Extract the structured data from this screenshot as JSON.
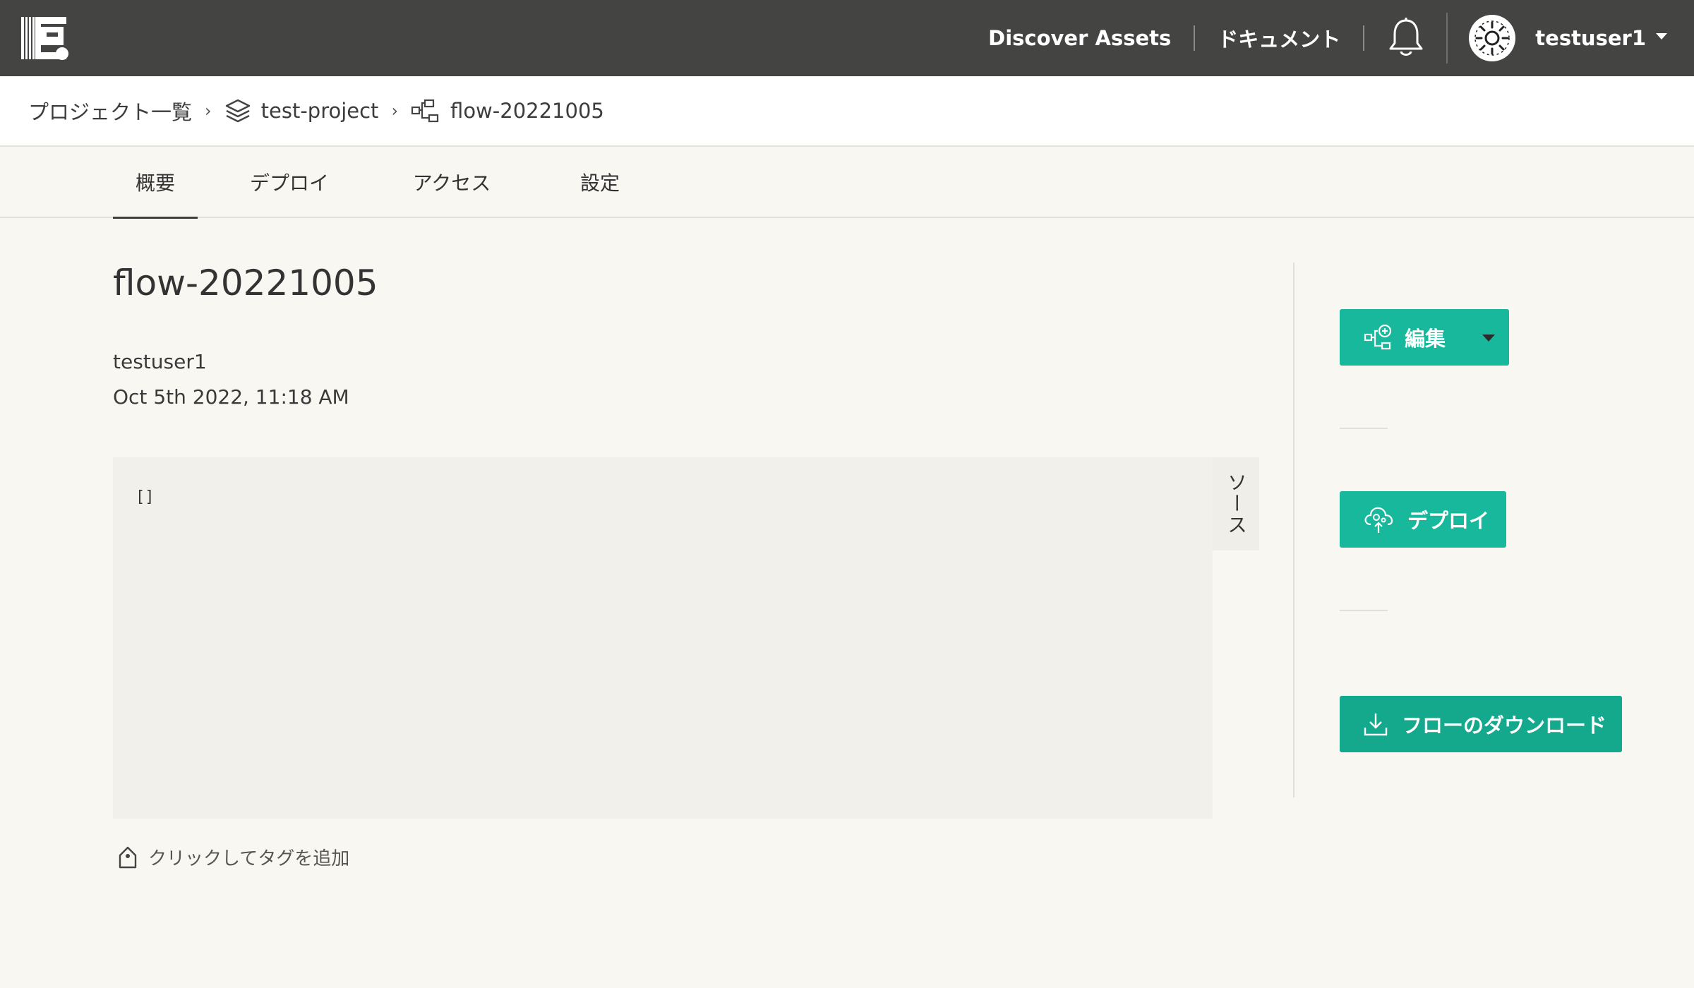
{
  "header": {
    "discover_label": "Discover Assets",
    "docs_label": "ドキュメント",
    "username": "testuser1"
  },
  "breadcrumb": {
    "projects_label": "プロジェクト一覧",
    "project_name": "test-project",
    "flow_name": "flow-20221005"
  },
  "tabs": [
    {
      "label": "概要",
      "active": true
    },
    {
      "label": "デプロイ",
      "active": false
    },
    {
      "label": "アクセス",
      "active": false
    },
    {
      "label": "設定",
      "active": false
    }
  ],
  "main": {
    "title": "flow-20221005",
    "author": "testuser1",
    "date": "Oct 5th 2022, 11:18 AM",
    "code": "[]",
    "source_tab": "ソース",
    "add_tag_label": "クリックしてタグを追加"
  },
  "actions": {
    "edit_label": "編集",
    "deploy_label": "デプロイ",
    "download_label": "フローのダウンロード"
  },
  "colors": {
    "topbar": "#444443",
    "accent": "#17b89c"
  }
}
